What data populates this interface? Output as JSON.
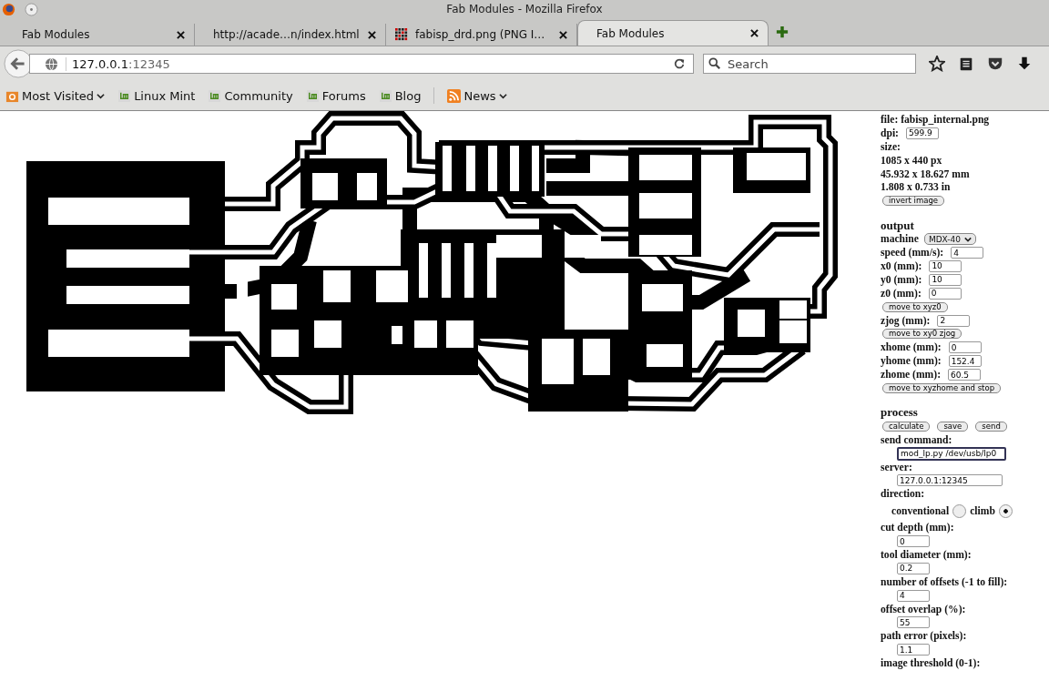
{
  "window": {
    "title": "Fab Modules - Mozilla Firefox"
  },
  "tabs": [
    {
      "label": "Fab Modules",
      "selected": false
    },
    {
      "label": "http://acade…n/index.html",
      "selected": false
    },
    {
      "label": "fabisp_drd.png (PNG I…",
      "kind": "image",
      "selected": false
    },
    {
      "label": "Fab Modules",
      "selected": true
    }
  ],
  "address": {
    "host": "127.0.0.1",
    "port": ":12345"
  },
  "search": {
    "placeholder": "Search"
  },
  "bookmarks": [
    {
      "label": "Most Visited",
      "kind": "folder",
      "menu": true
    },
    {
      "label": "Linux Mint",
      "kind": "mint",
      "menu": false
    },
    {
      "label": "Community",
      "kind": "mint",
      "menu": false
    },
    {
      "label": "Forums",
      "kind": "mint",
      "menu": false
    },
    {
      "label": "Blog",
      "kind": "mint",
      "menu": false
    },
    {
      "label": "News",
      "kind": "feed",
      "menu": true
    }
  ],
  "panel": {
    "items": [
      {
        "kind": "text",
        "text": "file: fabisp_internal.png"
      },
      {
        "kind": "field",
        "label": "dpi:",
        "value": "599.9"
      },
      {
        "kind": "text",
        "text": "size:"
      },
      {
        "kind": "text",
        "text": "1085 x 440 px"
      },
      {
        "kind": "text",
        "text": "45.932 x 18.627 mm"
      },
      {
        "kind": "text",
        "text": "1.808 x 0.733 in"
      },
      {
        "kind": "buttons",
        "buttons": [
          "invert image"
        ]
      },
      {
        "kind": "heading",
        "text": "output"
      },
      {
        "kind": "select",
        "label": "machine",
        "value": "MDX-40"
      },
      {
        "kind": "field",
        "label": "speed (mm/s):",
        "value": "4"
      },
      {
        "kind": "field",
        "label": "x0 (mm):",
        "value": "10"
      },
      {
        "kind": "field",
        "label": "y0 (mm):",
        "value": "10"
      },
      {
        "kind": "field",
        "label": "z0 (mm):",
        "value": "0"
      },
      {
        "kind": "buttons",
        "buttons": [
          "move to xyz0"
        ]
      },
      {
        "kind": "field",
        "label": "zjog (mm):",
        "value": "2"
      },
      {
        "kind": "buttons",
        "buttons": [
          "move to xy0 zjog"
        ]
      },
      {
        "kind": "field",
        "label": "xhome (mm):",
        "value": "0"
      },
      {
        "kind": "field",
        "label": "yhome (mm):",
        "value": "152.4"
      },
      {
        "kind": "field",
        "label": "zhome (mm):",
        "value": "60.5"
      },
      {
        "kind": "buttons",
        "buttons": [
          "move to xyzhome and stop"
        ]
      },
      {
        "kind": "heading",
        "text": "process"
      },
      {
        "kind": "buttons",
        "buttons": [
          "calculate",
          "save",
          "send"
        ]
      },
      {
        "kind": "text",
        "text": "send command:"
      },
      {
        "kind": "wide-input",
        "value": "mod_lp.py /dev/usb/lp0",
        "focused": true
      },
      {
        "kind": "text",
        "text": "server:"
      },
      {
        "kind": "wide-input",
        "value": "127.0.0.1:12345",
        "focused": false
      },
      {
        "kind": "text",
        "text": "direction:"
      },
      {
        "kind": "radios",
        "options": [
          {
            "label": "conventional",
            "selected": false
          },
          {
            "label": "climb",
            "selected": true
          }
        ]
      },
      {
        "kind": "text",
        "text": "cut depth (mm):"
      },
      {
        "kind": "input",
        "value": "0"
      },
      {
        "kind": "text",
        "text": "tool diameter (mm):"
      },
      {
        "kind": "input",
        "value": "0.2"
      },
      {
        "kind": "text",
        "text": "number of offsets (-1 to fill):"
      },
      {
        "kind": "input",
        "value": "4"
      },
      {
        "kind": "text",
        "text": "offset overlap (%):"
      },
      {
        "kind": "input",
        "value": "55"
      },
      {
        "kind": "text",
        "text": "path error (pixels):"
      },
      {
        "kind": "input",
        "value": "1.1"
      },
      {
        "kind": "text",
        "text": "image threshold (0-1):"
      }
    ]
  }
}
